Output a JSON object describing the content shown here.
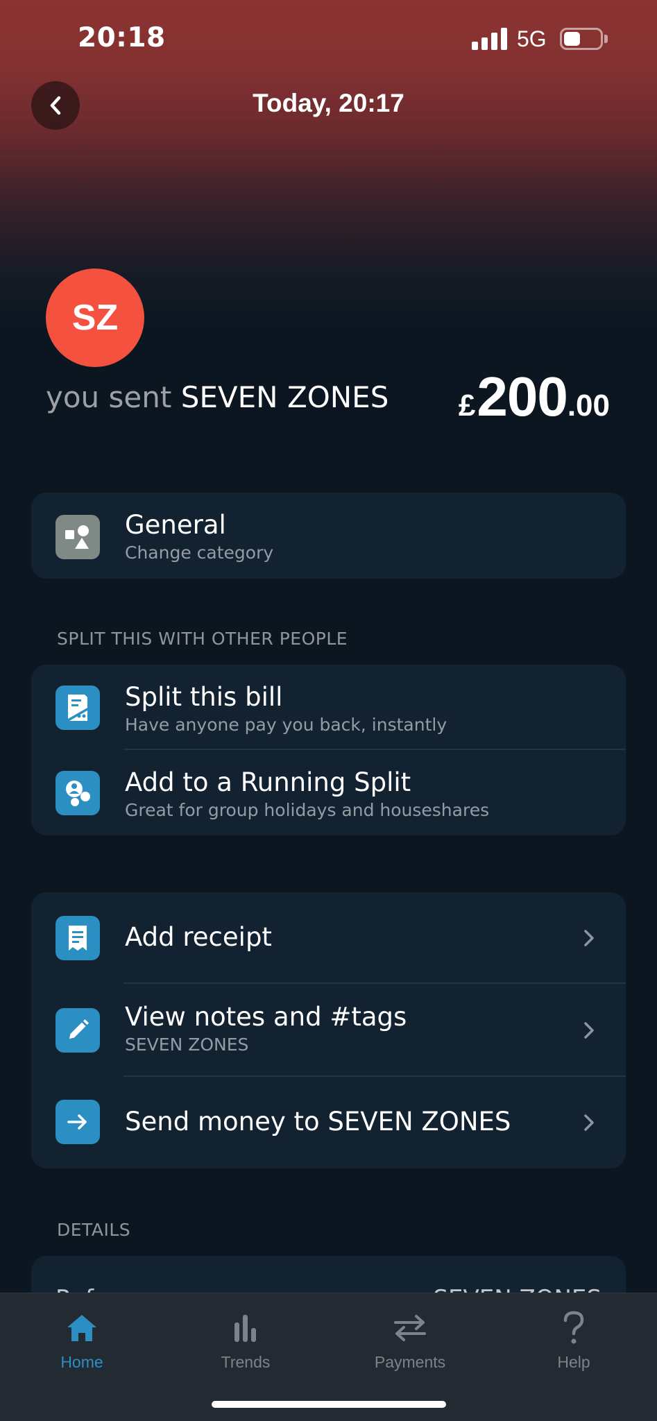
{
  "status_bar": {
    "time": "20:18",
    "network": "5G",
    "battery_level": 0.45
  },
  "header": {
    "title": "Today, 20:17",
    "back_icon": "chevron-left-icon"
  },
  "transaction": {
    "avatar_initials": "SZ",
    "avatar_color": "#f4523f",
    "direction_label": "you sent",
    "merchant": "SEVEN ZONES",
    "currency": "£",
    "amount_integer": "200",
    "amount_decimal": ".00"
  },
  "category": {
    "title": "General",
    "subtitle": "Change category",
    "icon": "shapes-icon"
  },
  "split_section": {
    "label": "SPLIT THIS WITH OTHER PEOPLE",
    "items": [
      {
        "title": "Split this bill",
        "subtitle": "Have anyone pay you back, instantly",
        "icon": "split-bill-icon"
      },
      {
        "title": "Add to a Running Split",
        "subtitle": "Great for group holidays and houseshares",
        "icon": "running-split-icon"
      }
    ]
  },
  "actions": {
    "items": [
      {
        "title": "Add receipt",
        "subtitle": "",
        "icon": "receipt-icon"
      },
      {
        "title": "View notes and #tags",
        "subtitle": "SEVEN ZONES",
        "icon": "pencil-icon"
      },
      {
        "title": "Send money to SEVEN ZONES",
        "subtitle": "",
        "icon": "arrow-right-icon"
      }
    ]
  },
  "details": {
    "label": "DETAILS",
    "first_row_label": "Ref",
    "first_row_value": "SEVEN ZONES"
  },
  "tab_bar": {
    "items": [
      {
        "label": "Home",
        "icon": "home-icon",
        "active": true
      },
      {
        "label": "Trends",
        "icon": "bar-chart-icon",
        "active": false
      },
      {
        "label": "Payments",
        "icon": "transfer-arrows-icon",
        "active": false
      },
      {
        "label": "Help",
        "icon": "question-icon",
        "active": false
      }
    ]
  },
  "colors": {
    "accent": "#2b8fc4",
    "background": "#0b1621",
    "card": "#132231",
    "header_gradient_top": "#8a3331"
  }
}
